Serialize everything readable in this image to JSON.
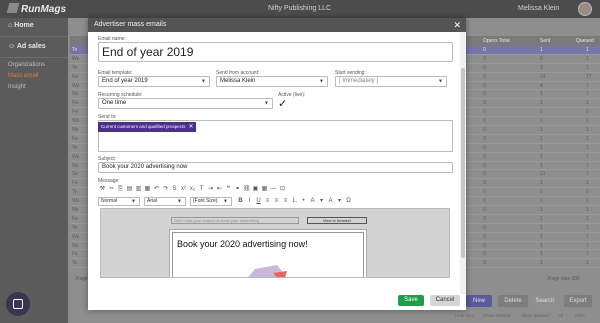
{
  "app": {
    "logo_text": "RunMags",
    "org_name": "Nifty Publishing LLC",
    "user_name": "Melissa Klein"
  },
  "sidebar": {
    "home": "Home",
    "ad_sales": "Ad sales",
    "items": [
      {
        "label": "Organizations"
      },
      {
        "label": "Mass email"
      },
      {
        "label": "Insight"
      }
    ]
  },
  "background_table": {
    "headers": [
      "",
      "Opens  Total",
      "Sent",
      "Queued"
    ],
    "rows": [
      {
        "c1": "0",
        "c2": "1",
        "c3": "1"
      },
      {
        "c1": "0",
        "c2": "8",
        "c3": "1"
      },
      {
        "c1": "0",
        "c2": "3",
        "c3": "1"
      },
      {
        "c1": "0",
        "c2": "14",
        "c3": "17"
      },
      {
        "c1": "0",
        "c2": "4",
        "c3": "1"
      },
      {
        "c1": "0",
        "c2": "1",
        "c3": "1"
      },
      {
        "c1": "0",
        "c2": "1",
        "c3": "1"
      },
      {
        "c1": "0",
        "c2": "1",
        "c3": "1"
      },
      {
        "c1": "0",
        "c2": "1",
        "c3": "1"
      },
      {
        "c1": "0",
        "c2": "1",
        "c3": "1"
      },
      {
        "c1": "0",
        "c2": "1",
        "c3": "1"
      },
      {
        "c1": "0",
        "c2": "1",
        "c3": "1"
      },
      {
        "c1": "0",
        "c2": "1",
        "c3": "1"
      },
      {
        "c1": "0",
        "c2": "1",
        "c3": "1"
      },
      {
        "c1": "0",
        "c2": "21",
        "c3": "1"
      },
      {
        "c1": "0",
        "c2": "1",
        "c3": "1"
      },
      {
        "c1": "0",
        "c2": "1",
        "c3": "1"
      },
      {
        "c1": "0",
        "c2": "1",
        "c3": "1"
      },
      {
        "c1": "0",
        "c2": "1",
        "c3": "1"
      },
      {
        "c1": "0",
        "c2": "1",
        "c3": "1"
      },
      {
        "c1": "0",
        "c2": "1",
        "c3": "1"
      },
      {
        "c1": "0",
        "c2": "1",
        "c3": "1"
      },
      {
        "c1": "0",
        "c2": "1",
        "c3": "1"
      },
      {
        "c1": "0",
        "c2": "1",
        "c3": "1"
      },
      {
        "c1": "0",
        "c2": "1",
        "c3": "1"
      }
    ],
    "row_prefix": [
      "Te",
      "We",
      "Te",
      "Re",
      "We",
      "Ne",
      "Re",
      "Fe",
      "We",
      "Ne",
      "Fe",
      "Te",
      "We",
      "Ne",
      "Se",
      "Fe",
      "Te",
      "We",
      "Ne",
      "Fe",
      "Te",
      "We",
      "Ne",
      "Fe",
      "Te"
    ],
    "pager_left": "Page 1",
    "pager_right": "Page size  100"
  },
  "background_actions": {
    "new": "New",
    "delete": "Delete",
    "search": "Search",
    "export": "Export",
    "footer": [
      "Hide sent",
      "Show deleted",
      "Show queued",
      "All",
      "Mine"
    ]
  },
  "modal": {
    "title": "Advertiser mass emails",
    "email_name_label": "Email name:",
    "email_name": "End of year 2019",
    "template_label": "Email template:",
    "template_value": "End of year 2019",
    "account_label": "Send from account:",
    "account_value": "Melissa Klein",
    "start_label": "Start sending:",
    "start_value": "[ Immediately ]",
    "schedule_label": "Recurring schedule:",
    "schedule_value": "One time",
    "active_label": "Active (live):",
    "active_checked": "✓",
    "sendto_label": "Send to:",
    "sendto_chip": "Current customers and qualified prospects",
    "subject_label": "Subject:",
    "subject_value": "Book your 2020 advertising now",
    "message_label": "Message:",
    "editor": {
      "style_select": "Normal",
      "font_select": "Arial",
      "size_select": "(Font Size)",
      "preview_link": "Don't miss your chance to book your advertising",
      "preview_browser": "View in browser",
      "email_heading": "Book your 2020 advertising now!"
    },
    "save": "Save",
    "cancel": "Cancel"
  },
  "colors": {
    "accent_purple": "#4a2f8c",
    "save_green": "#1f9d4c",
    "active_orange": "#e07a3a"
  }
}
